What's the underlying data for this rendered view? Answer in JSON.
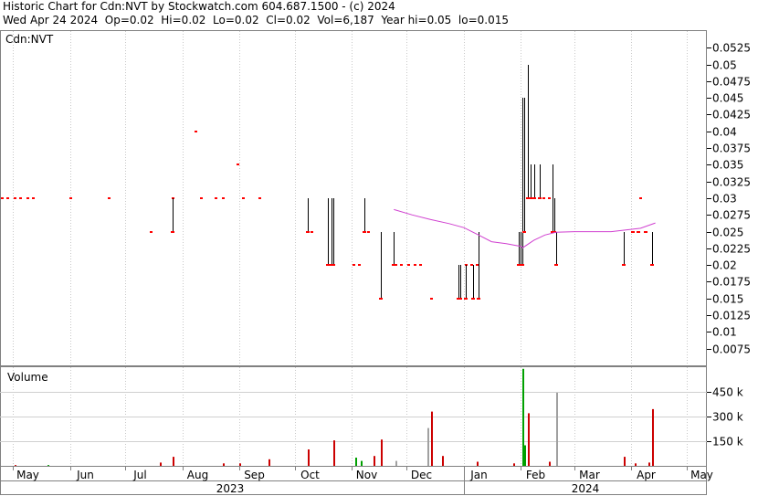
{
  "header": {
    "line1": "Historic Chart for Cdn:NVT by Stockwatch.com 604.687.1500 - (c) 2024",
    "line2": "Wed Apr 24 2024  Op=0.02  Hi=0.02  Lo=0.02  Cl=0.02  Vol=6,187  Year hi=0.05  lo=0.015"
  },
  "colors": {
    "price_down": "#ff0000",
    "price_up": "#000000",
    "moving_average": "#d040d0",
    "volume_down": "#cc0000",
    "volume_up": "#00a000",
    "volume_unchanged": "#a0a0a0"
  },
  "chart_data": [
    {
      "type": "line",
      "title": "Cdn:NVT",
      "ylim": [
        0.005,
        0.055
      ],
      "y_ticks": [
        "0.0525",
        "0.05",
        "0.0475",
        "0.045",
        "0.0425",
        "0.04",
        "0.0375",
        "0.035",
        "0.0325",
        "0.03",
        "0.0275",
        "0.025",
        "0.0225",
        "0.02",
        "0.0175",
        "0.015",
        "0.0125",
        "0.01",
        "0.0075"
      ],
      "x_tick_labels": [
        "May",
        "Jun",
        "Jul",
        "Aug",
        "Sep",
        "Oct",
        "Nov",
        "Dec",
        "Jan",
        "Feb",
        "Mar",
        "Apr",
        "May"
      ],
      "year_labels": [
        "2023",
        "2024"
      ],
      "price_ticks": [
        {
          "date": "2023-04-25",
          "close": 0.03
        },
        {
          "date": "2023-04-28",
          "close": 0.03
        },
        {
          "date": "2023-05-02",
          "close": 0.03
        },
        {
          "date": "2023-05-05",
          "close": 0.03
        },
        {
          "date": "2023-05-09",
          "close": 0.03
        },
        {
          "date": "2023-05-12",
          "close": 0.03
        },
        {
          "date": "2023-06-01",
          "close": 0.03
        },
        {
          "date": "2023-06-22",
          "close": 0.03
        },
        {
          "date": "2023-07-15",
          "close": 0.025
        },
        {
          "date": "2023-07-27",
          "close": 0.03
        },
        {
          "date": "2023-08-08",
          "close": 0.04
        },
        {
          "date": "2023-08-11",
          "close": 0.03
        },
        {
          "date": "2023-08-19",
          "close": 0.03
        },
        {
          "date": "2023-08-23",
          "close": 0.03
        },
        {
          "date": "2023-08-31",
          "close": 0.035
        },
        {
          "date": "2023-09-03",
          "close": 0.03
        },
        {
          "date": "2023-09-12",
          "close": 0.03
        },
        {
          "date": "2023-10-10",
          "close": 0.025
        },
        {
          "date": "2023-11-02",
          "close": 0.02
        },
        {
          "date": "2023-11-05",
          "close": 0.02
        },
        {
          "date": "2023-11-10",
          "close": 0.025
        },
        {
          "date": "2023-11-25",
          "close": 0.02
        },
        {
          "date": "2023-11-28",
          "close": 0.02
        },
        {
          "date": "2023-12-02",
          "close": 0.02
        },
        {
          "date": "2023-12-05",
          "close": 0.02
        },
        {
          "date": "2023-12-08",
          "close": 0.02
        },
        {
          "date": "2023-12-14",
          "close": 0.015
        },
        {
          "date": "2024-01-02",
          "close": 0.02
        },
        {
          "date": "2024-01-05",
          "close": 0.02
        },
        {
          "date": "2024-01-08",
          "close": 0.02
        },
        {
          "date": "2024-02-13",
          "close": 0.03
        },
        {
          "date": "2024-02-16",
          "close": 0.03
        },
        {
          "date": "2024-04-06",
          "close": 0.03
        }
      ],
      "price_ranges": [
        {
          "date": "2023-07-27",
          "low": 0.025,
          "high": 0.03
        },
        {
          "date": "2023-10-08",
          "low": 0.025,
          "high": 0.03
        },
        {
          "date": "2023-10-19",
          "low": 0.02,
          "high": 0.03
        },
        {
          "date": "2023-10-21",
          "low": 0.02,
          "high": 0.03
        },
        {
          "date": "2023-10-22",
          "low": 0.02,
          "high": 0.03
        },
        {
          "date": "2023-11-08",
          "low": 0.025,
          "high": 0.03
        },
        {
          "date": "2023-11-17",
          "low": 0.015,
          "high": 0.025
        },
        {
          "date": "2023-11-24",
          "low": 0.02,
          "high": 0.025
        },
        {
          "date": "2023-12-29",
          "low": 0.015,
          "high": 0.02
        },
        {
          "date": "2023-12-30",
          "low": 0.015,
          "high": 0.02
        },
        {
          "date": "2024-01-02",
          "low": 0.015,
          "high": 0.02
        },
        {
          "date": "2024-01-06",
          "low": 0.015,
          "high": 0.02
        },
        {
          "date": "2024-01-09",
          "low": 0.015,
          "high": 0.025
        },
        {
          "date": "2024-01-31",
          "low": 0.02,
          "high": 0.025
        },
        {
          "date": "2024-02-01",
          "low": 0.02,
          "high": 0.025
        },
        {
          "date": "2024-02-02",
          "low": 0.02,
          "high": 0.045
        },
        {
          "date": "2024-02-03",
          "low": 0.025,
          "high": 0.045
        },
        {
          "date": "2024-02-05",
          "low": 0.03,
          "high": 0.05
        },
        {
          "date": "2024-02-06",
          "low": 0.03,
          "high": 0.035
        },
        {
          "date": "2024-02-08",
          "low": 0.03,
          "high": 0.035
        },
        {
          "date": "2024-02-11",
          "low": 0.03,
          "high": 0.035
        },
        {
          "date": "2024-02-18",
          "low": 0.025,
          "high": 0.035
        },
        {
          "date": "2024-02-19",
          "low": 0.025,
          "high": 0.03
        },
        {
          "date": "2024-02-20",
          "low": 0.02,
          "high": 0.025
        },
        {
          "date": "2024-03-28",
          "low": 0.02,
          "high": 0.025
        },
        {
          "date": "2024-04-02",
          "low": 0.025,
          "high": 0.025
        },
        {
          "date": "2024-04-05",
          "low": 0.025,
          "high": 0.025
        },
        {
          "date": "2024-04-09",
          "low": 0.025,
          "high": 0.025
        },
        {
          "date": "2024-04-12",
          "low": 0.02,
          "high": 0.025
        }
      ],
      "moving_average": [
        {
          "date": "2023-11-24",
          "value": 0.0283
        },
        {
          "date": "2023-12-04",
          "value": 0.0275
        },
        {
          "date": "2023-12-14",
          "value": 0.0268
        },
        {
          "date": "2023-12-24",
          "value": 0.0262
        },
        {
          "date": "2024-01-01",
          "value": 0.0256
        },
        {
          "date": "2024-01-09",
          "value": 0.0245
        },
        {
          "date": "2024-01-16",
          "value": 0.0235
        },
        {
          "date": "2024-01-24",
          "value": 0.0232
        },
        {
          "date": "2024-02-01",
          "value": 0.0228
        },
        {
          "date": "2024-02-02",
          "value": 0.0226
        },
        {
          "date": "2024-02-08",
          "value": 0.0237
        },
        {
          "date": "2024-02-14",
          "value": 0.0245
        },
        {
          "date": "2024-02-20",
          "value": 0.0249
        },
        {
          "date": "2024-03-01",
          "value": 0.025
        },
        {
          "date": "2024-03-21",
          "value": 0.025
        },
        {
          "date": "2024-04-06",
          "value": 0.0255
        },
        {
          "date": "2024-04-14",
          "value": 0.0263
        }
      ]
    },
    {
      "type": "bar",
      "title": "Volume",
      "ylim": [
        0,
        600000
      ],
      "y_ticks": [
        "450 k",
        "300 k",
        "150 k"
      ],
      "bars": [
        {
          "date": "2023-05-02",
          "volume": 5000,
          "dir": "down"
        },
        {
          "date": "2023-05-20",
          "volume": 5000,
          "dir": "up"
        },
        {
          "date": "2023-07-20",
          "volume": 20000,
          "dir": "down"
        },
        {
          "date": "2023-07-27",
          "volume": 55000,
          "dir": "down"
        },
        {
          "date": "2023-08-23",
          "volume": 15000,
          "dir": "down"
        },
        {
          "date": "2023-09-01",
          "volume": 15000,
          "dir": "down"
        },
        {
          "date": "2023-09-17",
          "volume": 40000,
          "dir": "down"
        },
        {
          "date": "2023-10-08",
          "volume": 100000,
          "dir": "down"
        },
        {
          "date": "2023-10-22",
          "volume": 155000,
          "dir": "down"
        },
        {
          "date": "2023-11-03",
          "volume": 50000,
          "dir": "up"
        },
        {
          "date": "2023-11-06",
          "volume": 30000,
          "dir": "up"
        },
        {
          "date": "2023-11-13",
          "volume": 60000,
          "dir": "down"
        },
        {
          "date": "2023-11-17",
          "volume": 160000,
          "dir": "down"
        },
        {
          "date": "2023-11-25",
          "volume": 30000,
          "dir": "unchanged"
        },
        {
          "date": "2023-12-12",
          "volume": 230000,
          "dir": "unchanged"
        },
        {
          "date": "2023-12-14",
          "volume": 330000,
          "dir": "down"
        },
        {
          "date": "2023-12-20",
          "volume": 60000,
          "dir": "down"
        },
        {
          "date": "2024-01-08",
          "volume": 25000,
          "dir": "down"
        },
        {
          "date": "2024-01-28",
          "volume": 15000,
          "dir": "down"
        },
        {
          "date": "2024-02-02",
          "volume": 590000,
          "dir": "up"
        },
        {
          "date": "2024-02-03",
          "volume": 125000,
          "dir": "up"
        },
        {
          "date": "2024-02-05",
          "volume": 320000,
          "dir": "down"
        },
        {
          "date": "2024-02-16",
          "volume": 25000,
          "dir": "down"
        },
        {
          "date": "2024-02-20",
          "volume": 445000,
          "dir": "unchanged"
        },
        {
          "date": "2024-03-28",
          "volume": 55000,
          "dir": "down"
        },
        {
          "date": "2024-04-03",
          "volume": 15000,
          "dir": "down"
        },
        {
          "date": "2024-04-10",
          "volume": 20000,
          "dir": "down"
        },
        {
          "date": "2024-04-12",
          "volume": 345000,
          "dir": "down"
        }
      ]
    }
  ]
}
